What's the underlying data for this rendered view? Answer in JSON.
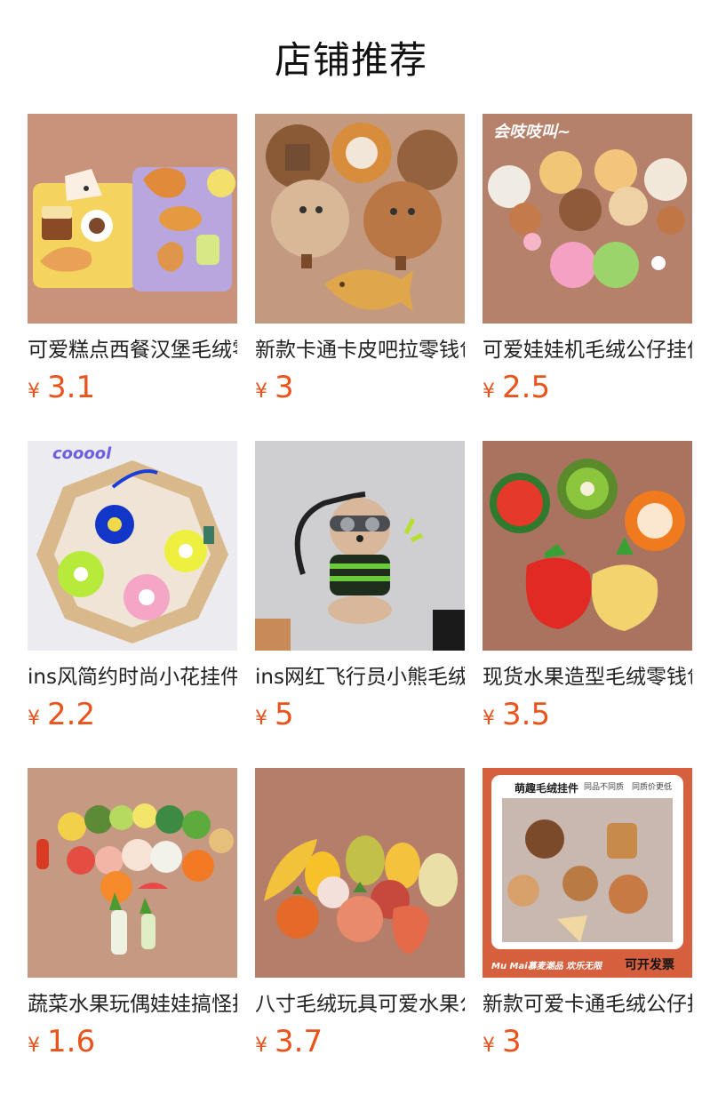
{
  "section": {
    "title": "店铺推荐"
  },
  "currency_symbol": "¥",
  "products": [
    {
      "name": "可爱糕点西餐汉堡毛绒零钱包",
      "price": "3.1",
      "bg": "#c9927a"
    },
    {
      "name": "新款卡通卡皮吧拉零钱包",
      "price": "3",
      "bg": "#c39a80"
    },
    {
      "name": "可爱娃娃机毛绒公仔挂件",
      "price": "2.5",
      "bg": "#b5816b",
      "overlay": "会吱吱叫~"
    },
    {
      "name": "ins风简约时尚小花挂件",
      "price": "2.2",
      "bg": "#ecebef",
      "overlay": "cooool"
    },
    {
      "name": "ins网红飞行员小熊毛绒挂件",
      "price": "5",
      "bg": "#cfcfd2"
    },
    {
      "name": "现货水果造型毛绒零钱包",
      "price": "3.5",
      "bg": "#a9735f"
    },
    {
      "name": "蔬菜水果玩偶娃娃搞怪挂件",
      "price": "1.6",
      "bg": "#c69983"
    },
    {
      "name": "八寸毛绒玩具可爱水果公仔",
      "price": "3.7",
      "bg": "#b47e6b"
    },
    {
      "name": "新款可爱卡通毛绒公仔挂件",
      "price": "3",
      "bg": "#d6603e",
      "poster_title": "萌趣毛绒挂件",
      "poster_tags": [
        "同品不同质",
        "同质价更低"
      ],
      "poster_footer_left": "Mu Mai慕麦潮品 欢乐无限",
      "poster_footer_right": "可开发票"
    }
  ]
}
